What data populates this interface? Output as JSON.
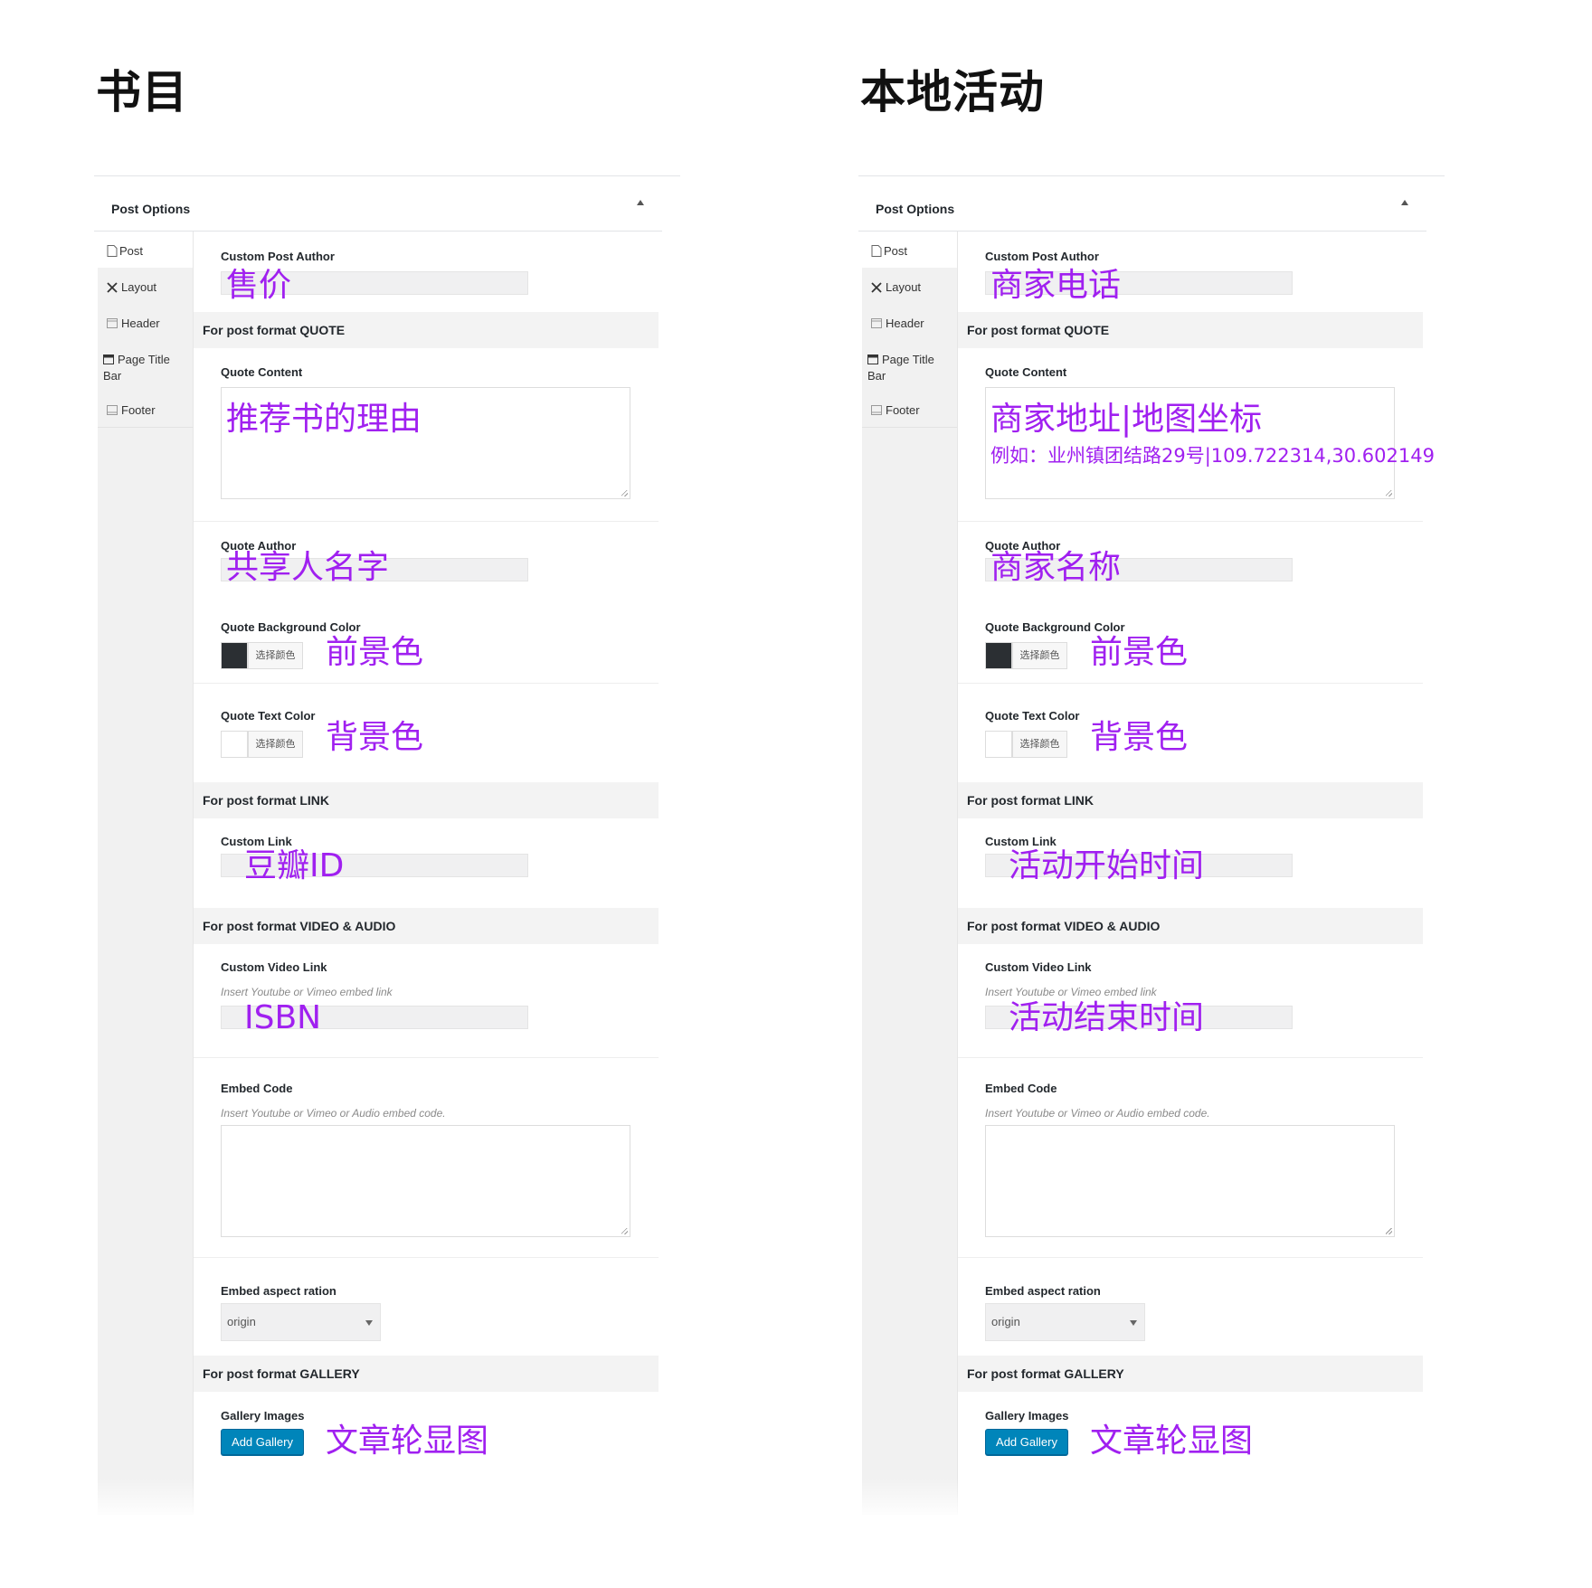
{
  "panels": [
    {
      "heading": "书目",
      "box_title": "Post Options",
      "nav": [
        "Post",
        "Layout",
        "Header",
        "Page Title",
        "Bar",
        "Footer"
      ],
      "sections": {
        "quote": "For post format QUOTE",
        "link": "For post format LINK",
        "video": "For post format VIDEO & AUDIO",
        "gallery": "For post format GALLERY"
      },
      "fields": {
        "custom_post_author": "Custom Post Author",
        "quote_content": "Quote Content",
        "quote_author": "Quote Author",
        "quote_bg_color": "Quote Background Color",
        "quote_text_color": "Quote Text Color",
        "custom_link": "Custom Link",
        "custom_video_link": "Custom Video Link",
        "video_hint": "Insert Youtube or Vimeo embed link",
        "embed_code": "Embed Code",
        "embed_hint": "Insert Youtube or Vimeo or Audio embed code.",
        "embed_aspect": "Embed aspect ration",
        "aspect_value": "origin",
        "gallery_images": "Gallery Images",
        "add_gallery": "Add Gallery",
        "pick_color": "选择颜色"
      },
      "annotations": {
        "author": "售价",
        "quote_content": "推荐书的理由",
        "quote_content_example": "",
        "quote_author": "共享人名字",
        "bg_color": "前景色",
        "text_color": "背景色",
        "link": "豆瓣ID",
        "video": "ISBN",
        "gallery": "文章轮显图"
      }
    },
    {
      "heading": "本地活动",
      "box_title": "Post Options",
      "nav": [
        "Post",
        "Layout",
        "Header",
        "Page Title",
        "Bar",
        "Footer"
      ],
      "sections": {
        "quote": "For post format QUOTE",
        "link": "For post format LINK",
        "video": "For post format VIDEO & AUDIO",
        "gallery": "For post format GALLERY"
      },
      "fields": {
        "custom_post_author": "Custom Post Author",
        "quote_content": "Quote Content",
        "quote_author": "Quote Author",
        "quote_bg_color": "Quote Background Color",
        "quote_text_color": "Quote Text Color",
        "custom_link": "Custom Link",
        "custom_video_link": "Custom Video Link",
        "video_hint": "Insert Youtube or Vimeo embed link",
        "embed_code": "Embed Code",
        "embed_hint": "Insert Youtube or Vimeo or Audio embed code.",
        "embed_aspect": "Embed aspect ration",
        "aspect_value": "origin",
        "gallery_images": "Gallery Images",
        "add_gallery": "Add Gallery",
        "pick_color": "选择颜色"
      },
      "annotations": {
        "author": "商家电话",
        "quote_content": "商家地址|地图坐标",
        "quote_content_example": "例如：业州镇团结路29号|109.722314,30.602149",
        "quote_author": "商家名称",
        "bg_color": "前景色",
        "text_color": "背景色",
        "link": "活动开始时间",
        "video": "活动结束时间",
        "gallery": "文章轮显图"
      }
    }
  ],
  "colors": {
    "annotation": "#a020f0",
    "dark_swatch": "#2b2f33",
    "light_swatch": "#ffffff",
    "button": "#0085ba"
  }
}
